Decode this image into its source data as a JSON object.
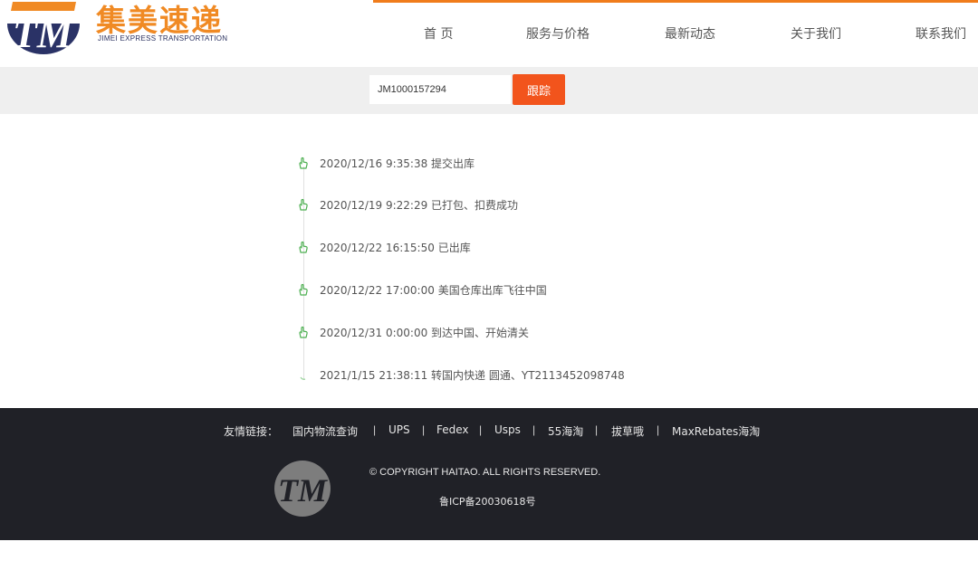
{
  "header": {
    "brand_cn": "集美速递",
    "brand_en": "JIMEI  EXPRESS TRANSPORTATION",
    "accent_color": "#f07c1b",
    "nav": [
      {
        "label": "首 页"
      },
      {
        "label": "服务与价格"
      },
      {
        "label": "最新动态"
      },
      {
        "label": "关于我们"
      },
      {
        "label": "联系我们"
      }
    ]
  },
  "search": {
    "value": "JM1000157294",
    "button_label": "跟踪",
    "button_color": "#f2541c"
  },
  "timeline": {
    "icon": "hand-pointer-icon",
    "icon_color": "#4caf50",
    "items": [
      {
        "text": "2020/12/16 9:35:38 提交出库"
      },
      {
        "text": "2020/12/19 9:22:29 已打包、扣费成功"
      },
      {
        "text": "2020/12/22 16:15:50 已出库"
      },
      {
        "text": "2020/12/22 17:00:00 美国仓库出库飞往中国"
      },
      {
        "text": "2020/12/31 0:00:00 到达中国、开始清关"
      },
      {
        "text": "2021/1/15 21:38:11 转国内快递 圆通、YT2113452098748"
      }
    ]
  },
  "footer": {
    "links_label": "友情链接：",
    "links": [
      {
        "label": "国内物流查询"
      },
      {
        "label": "UPS"
      },
      {
        "label": "Fedex"
      },
      {
        "label": "Usps"
      },
      {
        "label": "55海淘"
      },
      {
        "label": "拔草哦"
      },
      {
        "label": "MaxRebates海淘"
      }
    ],
    "separator": "|",
    "copyright": "© COPYRIGHT HAITAO. ALL RIGHTS RESERVED.",
    "icp": "鲁ICP备20030618号",
    "background": "#202127"
  }
}
